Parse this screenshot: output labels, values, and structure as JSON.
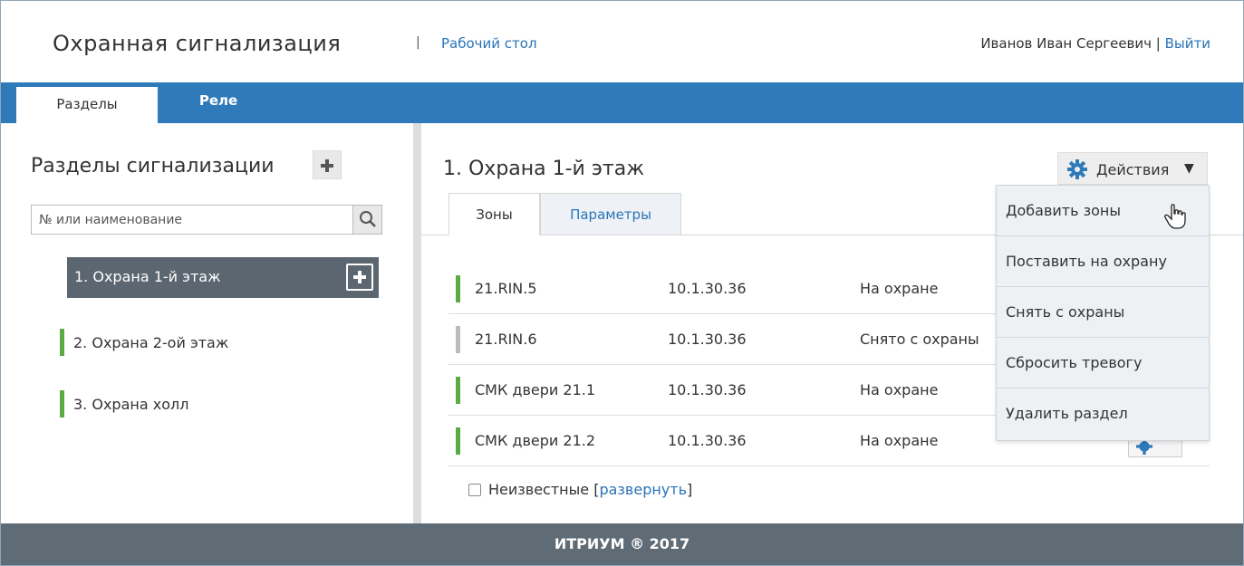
{
  "header": {
    "app_title": "Охранная сигнализация",
    "separator": "|",
    "desktop_link": "Рабочий стол",
    "user_name": "Иванов Иван Сергеевич",
    "user_sep": "|",
    "logout": "Выйти"
  },
  "topnav": {
    "tabs": [
      {
        "label": "Разделы",
        "active": true
      },
      {
        "label": "Реле",
        "active": false
      }
    ]
  },
  "sidebar": {
    "title": "Разделы сигнализации",
    "add_icon": "plus-icon",
    "search": {
      "placeholder": "№ или наименование",
      "value": "",
      "icon": "search-icon"
    },
    "items": [
      {
        "label": "1. Охрана 1-й этаж",
        "active": true
      },
      {
        "label": "2. Охрана 2-ой этаж",
        "active": false,
        "status_color": "#5bab45"
      },
      {
        "label": "3. Охрана холл",
        "active": false,
        "status_color": "#5bab45"
      }
    ]
  },
  "main": {
    "title": "1. Охрана 1-й этаж",
    "actions_label": "Действия",
    "actions_icon": "gear-icon",
    "tabs": [
      {
        "label": "Зоны",
        "active": true
      },
      {
        "label": "Параметры",
        "active": false
      }
    ],
    "zones": [
      {
        "name": "21.RIN.5",
        "ip": "10.1.30.36",
        "state": "На охране",
        "status_color": "#5bab45"
      },
      {
        "name": "21.RIN.6",
        "ip": "10.1.30.36",
        "state": "Снято с охраны",
        "status_color": "#bbbbbb"
      },
      {
        "name": "СМК двери 21.1",
        "ip": "10.1.30.36",
        "state": "На охране",
        "status_color": "#5bab45"
      },
      {
        "name": "СМК двери 21.2",
        "ip": "10.1.30.36",
        "state": "На охране",
        "status_color": "#5bab45"
      }
    ],
    "unknown_label": "Неизвестные",
    "unknown_bracket_open": "[",
    "unknown_expand": "развернуть",
    "unknown_bracket_close": "]"
  },
  "dropdown": {
    "items": [
      "Добавить зоны",
      "Поставить на охрану",
      "Снять с охраны",
      "Сбросить тревогу",
      "Удалить раздел"
    ]
  },
  "footer": {
    "text": "ИТРИУМ ® 2017"
  },
  "colors": {
    "accent": "#2f7ab9",
    "active_item": "#5c6670",
    "ok": "#5bab45",
    "off": "#bbbbbb",
    "footer": "#5f6b75"
  }
}
